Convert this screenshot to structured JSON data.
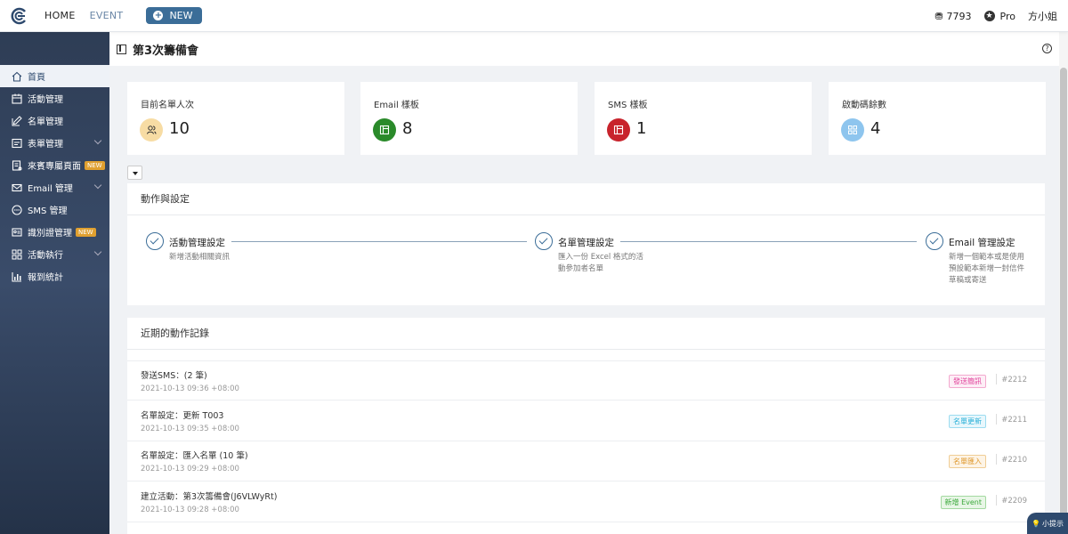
{
  "topbar": {
    "nav": [
      "HOME",
      "EVENT"
    ],
    "new_label": "NEW",
    "credits": "7793",
    "plan": "Pro",
    "user": "方小姐"
  },
  "sidebar": {
    "items": [
      {
        "label": "首頁",
        "icon": "home-icon"
      },
      {
        "label": "活動管理",
        "icon": "calendar-icon"
      },
      {
        "label": "名單管理",
        "icon": "edit-icon"
      },
      {
        "label": "表單管理",
        "icon": "form-icon"
      },
      {
        "label": "來賓專屬頁面",
        "icon": "guest-page-icon",
        "badge": "NEW"
      },
      {
        "label": "Email 管理",
        "icon": "mail-icon"
      },
      {
        "label": "SMS 管理",
        "icon": "sms-icon"
      },
      {
        "label": "識別證管理",
        "icon": "badge-icon",
        "badge": "NEW"
      },
      {
        "label": "活動執行",
        "icon": "grid-icon"
      },
      {
        "label": "報到統計",
        "icon": "chart-icon"
      }
    ]
  },
  "page": {
    "title": "第3次籌備會"
  },
  "stats": [
    {
      "label": "目前名單人次",
      "value": "10",
      "color": "#f7dca4",
      "icon": "people-icon"
    },
    {
      "label": "Email 樣板",
      "value": "8",
      "color": "#2a8a2a",
      "icon": "template-icon"
    },
    {
      "label": "SMS 樣板",
      "value": "1",
      "color": "#c8232c",
      "icon": "template-icon"
    },
    {
      "label": "啟動碼餘數",
      "value": "4",
      "color": "#8ec5ee",
      "icon": "qr-icon"
    }
  ],
  "actions": {
    "title": "動作與設定",
    "steps": [
      {
        "title": "活動管理設定",
        "desc": "新增活動相關資訊"
      },
      {
        "title": "名單管理設定",
        "desc": "匯入一份 Excel 格式的活動參加者名單"
      },
      {
        "title": "Email 管理設定",
        "desc": "新增一個範本或是使用預設範本新增一封信件草稿或寄送"
      }
    ]
  },
  "logs": {
    "title": "近期的動作記錄",
    "rows": [
      {
        "text": "發送SMS：(2 筆)",
        "date": "2021-10-13 09:36 +08:00",
        "tag": "發送簡訊",
        "tag_color": "#e0409a",
        "tag_bg": "#fdeef6",
        "id": "#2212"
      },
      {
        "text": "名單設定：更新 T003",
        "date": "2021-10-13 09:35 +08:00",
        "tag": "名單更新",
        "tag_color": "#2ab0d8",
        "tag_bg": "#e8f7fc",
        "id": "#2211"
      },
      {
        "text": "名單設定：匯入名單 (10 筆)",
        "date": "2021-10-13 09:29 +08:00",
        "tag": "名單匯入",
        "tag_color": "#e09a30",
        "tag_bg": "#fdf4e6",
        "id": "#2210"
      },
      {
        "text": "建立活動：第3次籌備會(J6VLWyRt)",
        "date": "2021-10-13 09:28 +08:00",
        "tag": "新增 Event",
        "tag_color": "#3aa83a",
        "tag_bg": "#e8f6e6",
        "id": "#2209"
      }
    ]
  },
  "tip_label": "小提示"
}
